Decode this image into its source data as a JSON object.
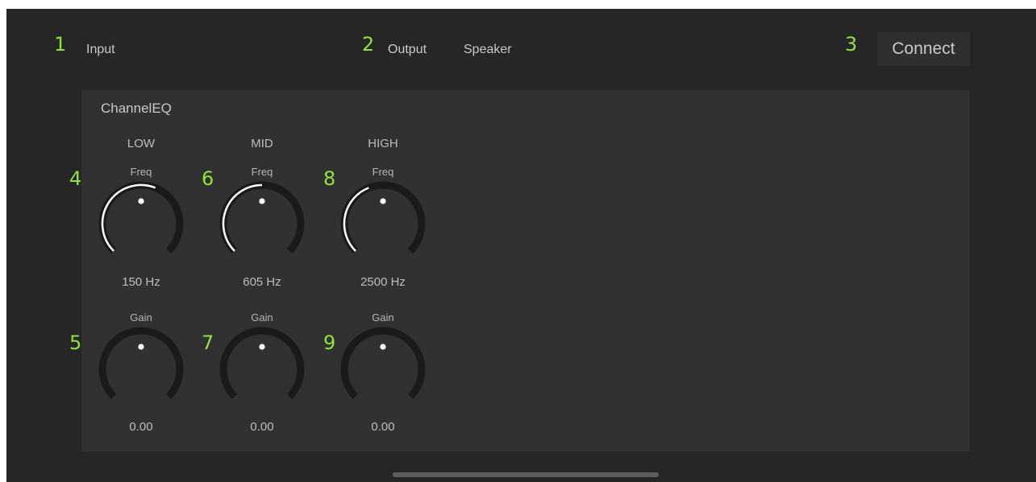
{
  "header": {
    "input_label": "Input",
    "output_label": "Output",
    "output_value": "Speaker",
    "connect_label": "Connect"
  },
  "annotations": [
    "1",
    "2",
    "3",
    "4",
    "5",
    "6",
    "7",
    "8",
    "9"
  ],
  "channel_eq": {
    "title": "ChannelEQ",
    "bands": [
      {
        "name": "LOW",
        "freq": {
          "label": "Freq",
          "value": "150 Hz",
          "level": 0.58
        },
        "gain": {
          "label": "Gain",
          "value": "0.00",
          "level": 0.0
        }
      },
      {
        "name": "MID",
        "freq": {
          "label": "Freq",
          "value": "605 Hz",
          "level": 0.5
        },
        "gain": {
          "label": "Gain",
          "value": "0.00",
          "level": 0.0
        }
      },
      {
        "name": "HIGH",
        "freq": {
          "label": "Freq",
          "value": "2500 Hz",
          "level": 0.42
        },
        "gain": {
          "label": "Gain",
          "value": "0.00",
          "level": 0.0
        }
      }
    ]
  },
  "colors": {
    "background": "#262626",
    "panel": "#313131",
    "annotation": "#8fe33a",
    "knob_track": "#1a1a1a",
    "knob_fill": "#ffffff"
  },
  "icons": {
    "knob": "rotary-knob-icon"
  }
}
